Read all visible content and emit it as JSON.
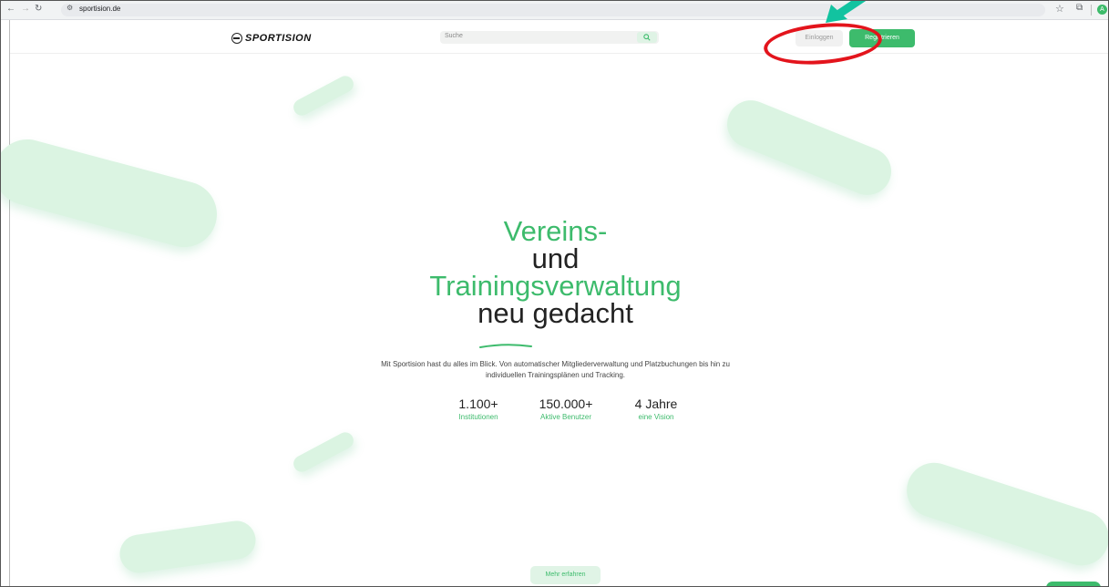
{
  "browser": {
    "url": "sportision.de",
    "profile_initial": "A"
  },
  "header": {
    "logo_text": "SPORTISION",
    "search_placeholder": "Suche",
    "login_label": "Einloggen",
    "register_label": "Registrieren"
  },
  "hero": {
    "line1": "Vereins-",
    "line2": "und",
    "line3": "Trainingsverwaltung",
    "line4_word1": "neu",
    "line4_word2": "gedacht",
    "description_line1": "Mit Sportision hast du alles im Blick. Von automatischer Mitgliederverwaltung und Platzbuchungen bis hin zu",
    "description_line2": "individuellen Trainingsplänen und Tracking."
  },
  "stats": [
    {
      "value": "1.100+",
      "label": "Institutionen"
    },
    {
      "value": "150.000+",
      "label": "Aktive Benutzer"
    },
    {
      "value": "4 Jahre",
      "label": "eine Vision"
    }
  ],
  "cta": {
    "more_label": "Mehr erfahren"
  },
  "colors": {
    "brand_green": "#3dbb6c",
    "pill_green": "#dbf4e2",
    "annotation_red": "#e3141c",
    "annotation_teal": "#12c3a0"
  }
}
